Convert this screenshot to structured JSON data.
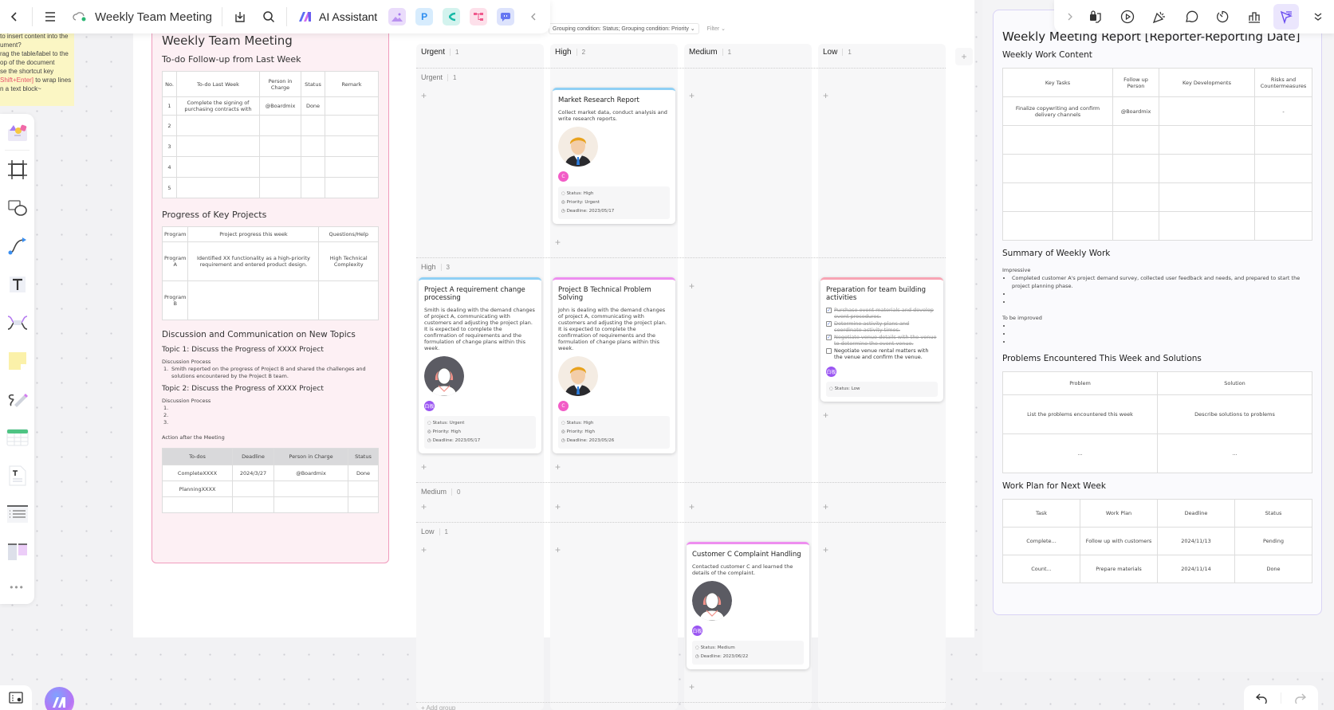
{
  "topbar": {
    "title": "Weekly Team Meeting",
    "ai_label": "AI Assistant",
    "icons": [
      "back-icon",
      "menu-icon",
      "cloud-sync-icon",
      "download-icon",
      "search-icon",
      "ai-logo-icon",
      "image-gen-icon",
      "presentation-icon",
      "mindmap-icon",
      "flowchart-icon",
      "chat-icon",
      "collapse-icon"
    ],
    "app_letters": {
      "presentation": "P"
    }
  },
  "right_toolbar": {
    "icons": [
      "expand-icon",
      "lock-note-icon",
      "play-icon",
      "celebrate-icon",
      "comment-icon",
      "timer-icon",
      "vote-icon",
      "presenter-cursor-icon",
      "more-chevrons-icon"
    ]
  },
  "sticky": {
    "lines": [
      "to insert content into the",
      "ument?",
      "rag the table/label to the",
      "op of the document",
      "se the shortcut key"
    ],
    "shortcut": "Shift+Enter]",
    "after_shortcut": " to wrap lines",
    "last": "n a text block~"
  },
  "left_tools": [
    "template-icon",
    "frame-icon",
    "shape-icon",
    "connector-icon",
    "text-icon",
    "mindmap-icon",
    "sticky-note-icon",
    "pen-icon",
    "table-icon",
    "document-icon",
    "list-icon",
    "layout-icon",
    "more-icon"
  ],
  "meeting_doc": {
    "title": "Weekly Team Meeting",
    "todo_heading": "To-do Follow-up from Last Week",
    "todo_headers": [
      "No.",
      "To-do Last Week",
      "Person in Charge",
      "Status",
      "Remark"
    ],
    "todo_rows": [
      [
        "1",
        "Complete the signing of purchasing contracts with",
        "@Boardmix",
        "Done",
        ""
      ],
      [
        "2",
        "",
        "",
        "",
        ""
      ],
      [
        "3",
        "",
        "",
        "",
        ""
      ],
      [
        "4",
        "",
        "",
        "",
        ""
      ],
      [
        "5",
        "",
        "",
        "",
        ""
      ]
    ],
    "progress_heading": "Progress of Key Projects",
    "progress_headers": [
      "Program",
      "Project progress this week",
      "Questions/Help"
    ],
    "progress_rows": [
      [
        "Program A",
        "Identified XX functionality as a high-priority requirement and entered product design.",
        "High Technical Complexity"
      ],
      [
        "Program B",
        "",
        ""
      ]
    ],
    "discussion_heading": "Discussion and Communication on New Topics",
    "topic1": "Topic 1: Discuss the Progress of XXXX Project",
    "process_label": "Discussion Process",
    "topic1_item": "Smith reported on the progress of Project B and shared the challenges and solutions encountered by the Project B team.",
    "topic2": "Topic 2: Discuss the Progress of XXXX Project",
    "topic2_items": [
      "1.",
      "2.",
      "3."
    ],
    "action_label": "Action after the Meeting",
    "action_headers": [
      "To-dos",
      "Deadline",
      "Person in Charge",
      "Status"
    ],
    "action_rows": [
      [
        "CompleteXXXX",
        "2024/3/27",
        "@Boardmix",
        "Done"
      ],
      [
        "PlanningXXXX",
        "",
        "",
        ""
      ],
      [
        "",
        "",
        "",
        ""
      ]
    ]
  },
  "kanban": {
    "grouping": "Grouping condition: Status; Grouping condition: Priority",
    "filter": "Filter",
    "columns": [
      {
        "name": "Urgent",
        "count": "1"
      },
      {
        "name": "High",
        "count": "2"
      },
      {
        "name": "Medium",
        "count": "1"
      },
      {
        "name": "Low",
        "count": "1"
      }
    ],
    "groups": [
      {
        "name": "Urgent",
        "count": "1"
      },
      {
        "name": "High",
        "count": "3"
      },
      {
        "name": "Medium",
        "count": "0"
      },
      {
        "name": "Low",
        "count": "1"
      }
    ],
    "add_group": "+ Add group",
    "cards": {
      "market": {
        "title": "Market Research Report",
        "desc": "Collect market data, conduct analysis and write research reports.",
        "badge": "C",
        "status": "Status: High",
        "priority": "Priority: Urgent",
        "deadline": "Deadline: 2023/05/17"
      },
      "projA": {
        "title": "Project A requirement change processing",
        "desc": "Smith is dealing with the demand changes of project A, communicating with customers and adjusting the project plan. It is expected to complete the confirmation of requirements and the formulation of change plans within this week.",
        "badge": "白板",
        "status": "Status: Urgent",
        "priority": "Priority: High",
        "deadline": "Deadline: 2023/05/17"
      },
      "projB": {
        "title": "Project B Technical Problem Solving",
        "desc": "John is dealing with the demand changes of project A, communicating with customers and adjusting the project plan. It is expected to complete the confirmation of requirements and the formulation of change plans within this week.",
        "badge": "C",
        "status": "Status: High",
        "priority": "Priority: High",
        "deadline": "Deadline: 2023/05/26"
      },
      "team": {
        "title": "Preparation for team building activities",
        "checklist": [
          {
            "text": "Purchase event materials and develop event procedures.",
            "done": true
          },
          {
            "text": "Determine activity plans and coordinate activity times.",
            "done": true
          },
          {
            "text": "Negotiate venue details with the venue to determine the event venue.",
            "done": true
          },
          {
            "text": "Negotiate venue rental matters with the venue and confirm the venue.",
            "done": false
          }
        ],
        "badge": "白板",
        "status": "Status: Low"
      },
      "customer": {
        "title": "Customer C Complaint Handling",
        "desc": "Contacted customer C and learned the details of the complaint.",
        "badge": "白板",
        "status": "Status: Medium",
        "deadline": "Deadline: 2023/06/22"
      }
    }
  },
  "report": {
    "title": "Weekly Meeting Report [Reporter-Reporting Date]",
    "work_heading": "Weekly Work Content",
    "work_headers": [
      "Key Tasks",
      "Follow up Person",
      "Key Developments",
      "Risks and Countermeasures"
    ],
    "work_rows": [
      [
        "Finalize copywriting and confirm delivery channels",
        "@Boardmix",
        "",
        "-"
      ],
      [
        "",
        "",
        "",
        ""
      ],
      [
        "",
        "",
        "",
        ""
      ],
      [
        "",
        "",
        "",
        ""
      ],
      [
        "",
        "",
        "",
        ""
      ]
    ],
    "summary_heading": "Summary of Weekly Work",
    "impressive_label": "Impressive",
    "impressive_items": [
      "Completed customer A's project demand survey, collected user feedback and needs, and prepared to start the project planning phase.",
      "",
      ""
    ],
    "improve_label": "To be improved",
    "improve_items": [
      "",
      "",
      ""
    ],
    "problems_heading": "Problems Encountered This Week and Solutions",
    "problems_headers": [
      "Problem",
      "Solution"
    ],
    "problems_rows": [
      [
        "List the problems encountered this week",
        "Describe solutions to problems"
      ],
      [
        "...",
        "..."
      ]
    ],
    "plan_heading": "Work Plan for Next Week",
    "plan_headers": [
      "Task",
      "Work Plan",
      "Deadline",
      "Status"
    ],
    "plan_rows": [
      [
        "Complete...",
        "Follow up with customers",
        "2024/11/13",
        "Pending"
      ],
      [
        "Count...",
        "Prepare materials",
        "2024/11/14",
        "Done"
      ]
    ]
  },
  "colors": {
    "accent": "#7b61ff",
    "doc_border": "#f09bbd",
    "report_border": "#d9d3f5",
    "badge_pink": "#f25cc7",
    "badge_purple": "#9a55f2"
  }
}
